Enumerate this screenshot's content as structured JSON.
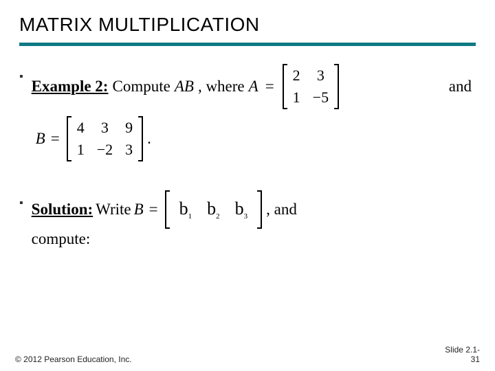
{
  "header": {
    "title": "MATRIX MULTIPLICATION"
  },
  "example": {
    "label_strong": "Example 2:",
    "text_1": " Compute ",
    "AB": "AB",
    "text_2": ", where ",
    "A": "A",
    "eq": "=",
    "matrixA": {
      "r1c1": "2",
      "r1c2": "3",
      "r2c1": "1",
      "r2c2": "−5"
    },
    "trail": "and"
  },
  "Bdef": {
    "B": "B",
    "eq": "=",
    "matrixB": {
      "r1c1": "4",
      "r1c2": "3",
      "r1c3": "9",
      "r2c1": "1",
      "r2c2": "−2",
      "r2c3": "3"
    },
    "period": "."
  },
  "solution": {
    "label_strong": "Solution:",
    "text_1": " Write ",
    "B": "B",
    "eq": "=",
    "cols": {
      "b1": "b",
      "s1": "1",
      "b2": "b",
      "s2": "2",
      "b3": "b",
      "s3": "3"
    },
    "trail": ", and",
    "line2": "compute:"
  },
  "footer": {
    "copyright": "© 2012 Pearson Education, Inc.",
    "slide_l1": "Slide 2.1-",
    "slide_l2": "31"
  }
}
